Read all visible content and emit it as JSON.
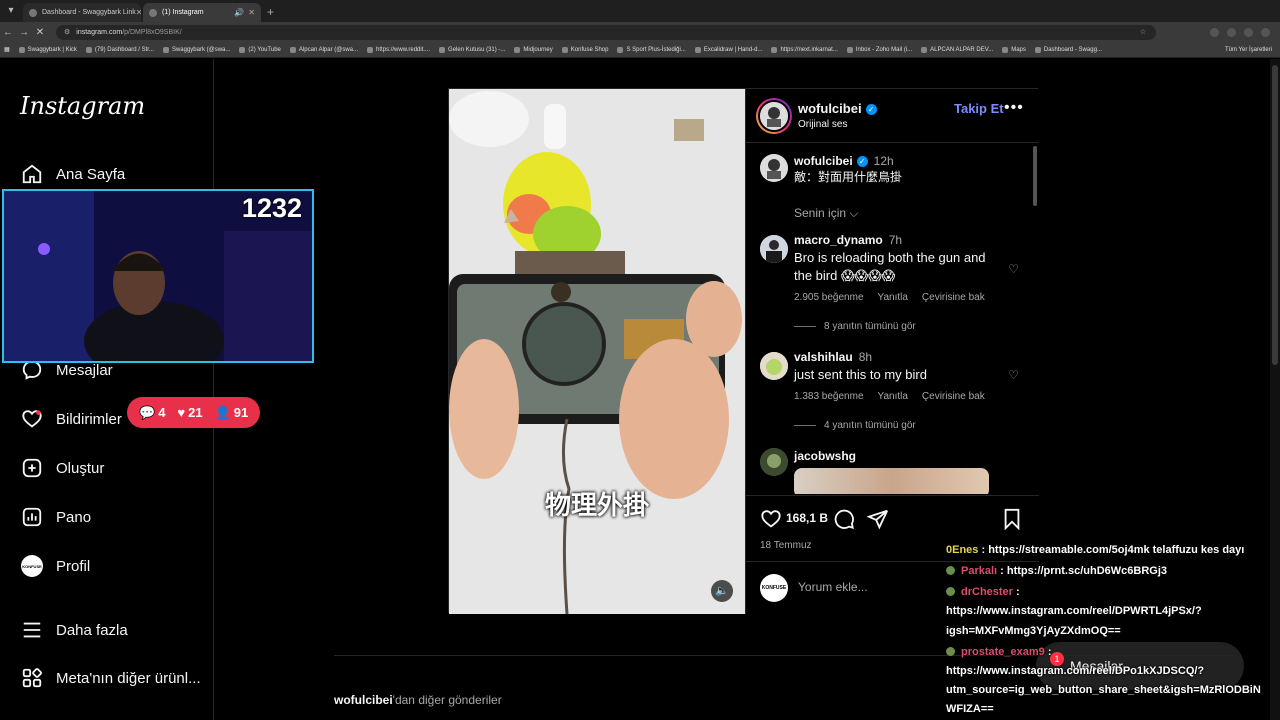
{
  "browser": {
    "tabs": [
      {
        "title": "Dashboard - Swaggybark Link"
      },
      {
        "title": "(1) Instagram"
      }
    ],
    "new_tab": "+",
    "url": {
      "host": "instagram.com",
      "path": "/p/DMPl8xO9SBIK/"
    },
    "bookmarks": [
      "Swaggybark | Kick",
      "(79) Dashboard / Str...",
      "Swaggybark (@swa...",
      "(2) YouTube",
      "Alpcan Alpar (@swa...",
      "https://www.reddit....",
      "Gelen Kutusu (31) -...",
      "Midjourney",
      "Konfuse Shop",
      "S Sport Plus-İstediği...",
      "Excalidraw | Hand-d...",
      "https://next.inkarnat...",
      "Inbox - Zoho Mail (i...",
      "ALPCAN ALPAR DEV...",
      "Maps",
      "Dashboard - Swagg..."
    ],
    "bookmarks_other": "Tüm Yer İşaretleri"
  },
  "sidebar": {
    "logo": "Instagram",
    "items": [
      {
        "label": "Ana Sayfa",
        "icon": "home-icon"
      },
      {
        "label": "Mesajlar",
        "icon": "messenger-icon"
      },
      {
        "label": "Bildirimler",
        "icon": "heart-icon"
      },
      {
        "label": "Oluştur",
        "icon": "create-icon"
      },
      {
        "label": "Pano",
        "icon": "dashboard-icon"
      },
      {
        "label": "Profil",
        "icon": "profile-icon"
      },
      {
        "label": "Daha fazla",
        "icon": "menu-icon"
      },
      {
        "label": "Meta'nın diğer ürünl...",
        "icon": "apps-icon"
      }
    ],
    "profile_avatar_text": "KONFUSE"
  },
  "post": {
    "username": "wofulcibei",
    "audio": "Orijinal ses",
    "follow": "Takip Et",
    "more": "•••",
    "subtitle": "物理外掛",
    "caption": {
      "user": "wofulcibei",
      "time": "12h",
      "text": "敵：對面用什麼鳥掛"
    },
    "for_you": "Senin için ⌵",
    "comments": [
      {
        "user": "macro_dynamo",
        "time": "7h",
        "text": "Bro is reloading both the gun and the bird 😱😱😱😱",
        "likes": "2.905 beğenme",
        "reply": "Yanıtla",
        "translate": "Çevirisine bak",
        "view_replies": "8 yanıtın tümünü gör"
      },
      {
        "user": "valshihlau",
        "time": "8h",
        "text": "just sent this to my bird",
        "likes": "1.383 beğenme",
        "reply": "Yanıtla",
        "translate": "Çevirisine bak",
        "view_replies": "4 yanıtın tümünü gör"
      },
      {
        "user": "jacobwshg"
      }
    ],
    "like_count": "168,1 B",
    "date": "18 Temmuz",
    "add_comment_placeholder": "Yorum ekle...",
    "more_posts_user": "wofulcibei",
    "more_posts_suffix": "'dan diğer gönderiler"
  },
  "overlay": {
    "webcam_counter": "1232",
    "stats": {
      "comments": "4",
      "hearts": "21",
      "followers": "91"
    },
    "chat": [
      {
        "user": "0Enes",
        "text": ": https://streamable.com/5oj4mk telaffuzu kes dayı"
      },
      {
        "user": "Parkalı",
        "text": ": https://prnt.sc/uhD6Wc6BRGj3"
      },
      {
        "user": "drChester",
        "text": ":"
      },
      {
        "text": "https://www.instagram.com/reel/DPWRTL4jPSx/?"
      },
      {
        "text": "igsh=MXFvMmg3YjAyZXdmOQ=="
      },
      {
        "user": "prostate_exam9",
        "text": ":"
      },
      {
        "text": "https://www.instagram.com/reel/DPo1kXJDSCQ/?"
      },
      {
        "text": "utm_source=ig_web_button_share_sheet&igsh=MzRlODBiN"
      },
      {
        "text": "WFIZA=="
      }
    ],
    "messages_pill": {
      "label": "Mesajlar",
      "badge": "1"
    }
  },
  "colors": {
    "accent_blue": "#0095f6",
    "follow_text": "#7a8cff",
    "stats_bg": "#e8304a",
    "webcam_border": "#2cc0e8",
    "chat_name_yellow": "#e8d64a",
    "chat_name_red": "#d94f6b"
  }
}
